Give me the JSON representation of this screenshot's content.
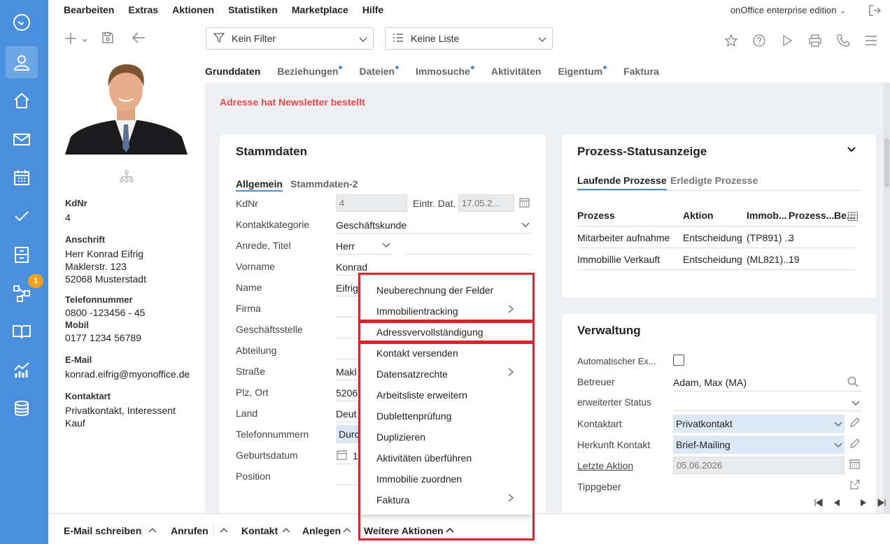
{
  "app": {
    "edition": "onOffice enterprise edition"
  },
  "menu": [
    "Bearbeiten",
    "Extras",
    "Aktionen",
    "Statistiken",
    "Marketplace",
    "Hilfe"
  ],
  "sidebar": {
    "items": [
      "dashboard-icon",
      "user-icon",
      "home-icon",
      "mail-icon",
      "calendar-icon",
      "check-icon",
      "cabinet-icon",
      "workflow-icon",
      "book-icon",
      "statistics-icon",
      "database-icon"
    ],
    "badge": "1"
  },
  "toolbar": {
    "filter": "Kein Filter",
    "list": "Keine Liste"
  },
  "tabs": [
    {
      "label": "Grunddaten",
      "dot": false
    },
    {
      "label": "Beziehungen",
      "dot": true
    },
    {
      "label": "Dateien",
      "dot": true
    },
    {
      "label": "Immosuche",
      "dot": true
    },
    {
      "label": "Aktivitäten",
      "dot": false
    },
    {
      "label": "Eigentum",
      "dot": true
    },
    {
      "label": "Faktura",
      "dot": false
    }
  ],
  "newsletter_notice": "Adresse hat Newsletter bestellt",
  "contact": {
    "kdnr_label": "KdNr",
    "kdnr": "4",
    "anschrift_label": "Anschrift",
    "anschrift": [
      "Herr Konrad Eifrig",
      "Maklerstr. 123",
      "52068 Musterstadt"
    ],
    "telefon_label": "Telefonnummer",
    "telefon": "0800 -123456 - 45",
    "mobil_label": "Mobil",
    "mobil": "0177 1234 56789",
    "email_label": "E-Mail",
    "email": "konrad.eifrig@myonoffice.de",
    "kontaktart_label": "Kontaktart",
    "kontaktart": [
      "Privatkontakt, Interessent",
      "Kauf"
    ]
  },
  "stammdaten": {
    "title": "Stammdaten",
    "subtabs": [
      "Allgemein",
      "Stammdaten-2"
    ],
    "fields": [
      {
        "label": "KdNr",
        "value": "4"
      },
      {
        "label": "Kontaktkategorie",
        "value": "Geschäftskunde"
      },
      {
        "label": "Anrede, Titel",
        "value": "Herr"
      },
      {
        "label": "Vorname",
        "value": "Konrad"
      },
      {
        "label": "Name",
        "value": "Eifrig"
      },
      {
        "label": "Firma",
        "value": ""
      },
      {
        "label": "Geschäftsstelle",
        "value": ""
      },
      {
        "label": "Abteilung",
        "value": ""
      },
      {
        "label": "Straße",
        "value": "Makl"
      },
      {
        "label": "Plz, Ort",
        "value": "5206"
      },
      {
        "label": "Land",
        "value": "Deut"
      },
      {
        "label": "Telefonnummern",
        "value": "Durc"
      },
      {
        "label": "Geburtsdatum",
        "value": "1"
      },
      {
        "label": "Position",
        "value": ""
      }
    ],
    "eintr_label": "Eintr. Dat.",
    "eintr_value": "17.05.2..."
  },
  "prozess": {
    "title": "Prozess-Statusanzeige",
    "subtabs": [
      "Laufende Prozesse",
      "Erledigte Prozesse"
    ],
    "columns": [
      "Prozess",
      "Aktion",
      "Immob...",
      "Prozess...",
      "Be..."
    ],
    "rows": [
      [
        "Mitarbeiter aufnahme",
        "Entscheidung",
        "(TP891) ...",
        "3"
      ],
      [
        "Immobillie Verkauft",
        "Entscheidung",
        "(ML821)...",
        "19"
      ]
    ]
  },
  "verwaltung": {
    "title": "Verwaltung",
    "fields": [
      {
        "label": "Automatischer Ex...",
        "value": ""
      },
      {
        "label": "Betreuer",
        "value": "Adam, Max (MA)"
      },
      {
        "label": "erweiterter Status",
        "value": ""
      },
      {
        "label": "Kontaktart",
        "value": "Privatkontakt"
      },
      {
        "label": "Herkunft Kontakt",
        "value": "Brief-Mailing"
      },
      {
        "label": "Letzte Aktion",
        "value": "05.06.2026"
      },
      {
        "label": "Tippgeber",
        "value": ""
      }
    ]
  },
  "dropdown": {
    "items": [
      {
        "label": "Neuberechnung der Felder",
        "arrow": false
      },
      {
        "label": "Immobilientracking",
        "arrow": true
      },
      {
        "label": "Adressvervollständigung",
        "arrow": false
      },
      {
        "label": "Kontakt versenden",
        "arrow": false
      },
      {
        "label": "Datensatzrechte",
        "arrow": true
      },
      {
        "label": "Arbeitsliste erweitern",
        "arrow": false
      },
      {
        "label": "Dublettenprüfung",
        "arrow": false
      },
      {
        "label": "Duplizieren",
        "arrow": false
      },
      {
        "label": "Aktivitäten überführen",
        "arrow": false
      },
      {
        "label": "Immobilie zuordnen",
        "arrow": false
      },
      {
        "label": "Faktura",
        "arrow": true
      }
    ]
  },
  "bottom": {
    "email": "E-Mail schreiben",
    "anrufen": "Anrufen",
    "kontakt": "Kontakt",
    "anlegen": "Anlegen",
    "weitere": "Weitere Aktionen"
  }
}
